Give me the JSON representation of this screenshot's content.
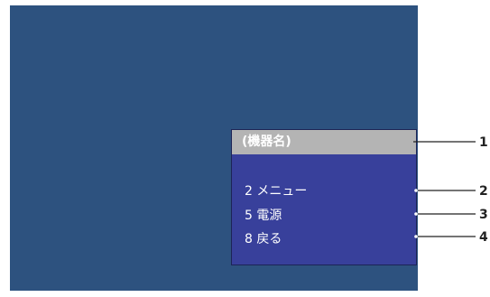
{
  "panel": {
    "title": "(機器名)",
    "items": [
      {
        "label": "2 メニュー"
      },
      {
        "label": "5 電源"
      },
      {
        "label": "8 戻る"
      }
    ]
  },
  "callouts": [
    "1",
    "2",
    "3",
    "4"
  ],
  "colors": {
    "screen_background": "#2d527f",
    "panel_background": "#38409b",
    "title_bar": "#b4b4b4",
    "text": "#ffffff",
    "leader_line": "#222222"
  }
}
